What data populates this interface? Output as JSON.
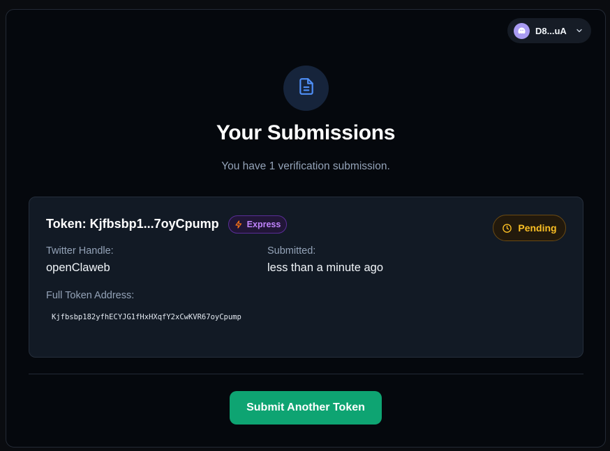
{
  "wallet": {
    "address": "D8...uA",
    "avatar_icon": "ghost-icon",
    "dropdown_icon": "chevron-down-icon"
  },
  "header": {
    "icon": "document-icon",
    "title": "Your Submissions",
    "subtitle": "You have 1 verification submission."
  },
  "submission": {
    "token_title": "Token: Kjfbsbp1...7oyCpump",
    "badge": {
      "label": "Express",
      "icon": "lightning-icon",
      "color": "#c084fc"
    },
    "status": {
      "label": "Pending",
      "icon": "clock-icon",
      "color": "#fbbf24"
    },
    "twitter_label": "Twitter Handle:",
    "twitter_value": "openClaweb",
    "submitted_label": "Submitted:",
    "submitted_value": "less than a minute ago",
    "address_label": "Full Token Address:",
    "address_value": "Kjfbsbp182yfhECYJG1fHxHXqfY2xCwKVR67oyCpump"
  },
  "actions": {
    "submit_another_label": "Submit Another Token",
    "accent": "#0ea472"
  }
}
